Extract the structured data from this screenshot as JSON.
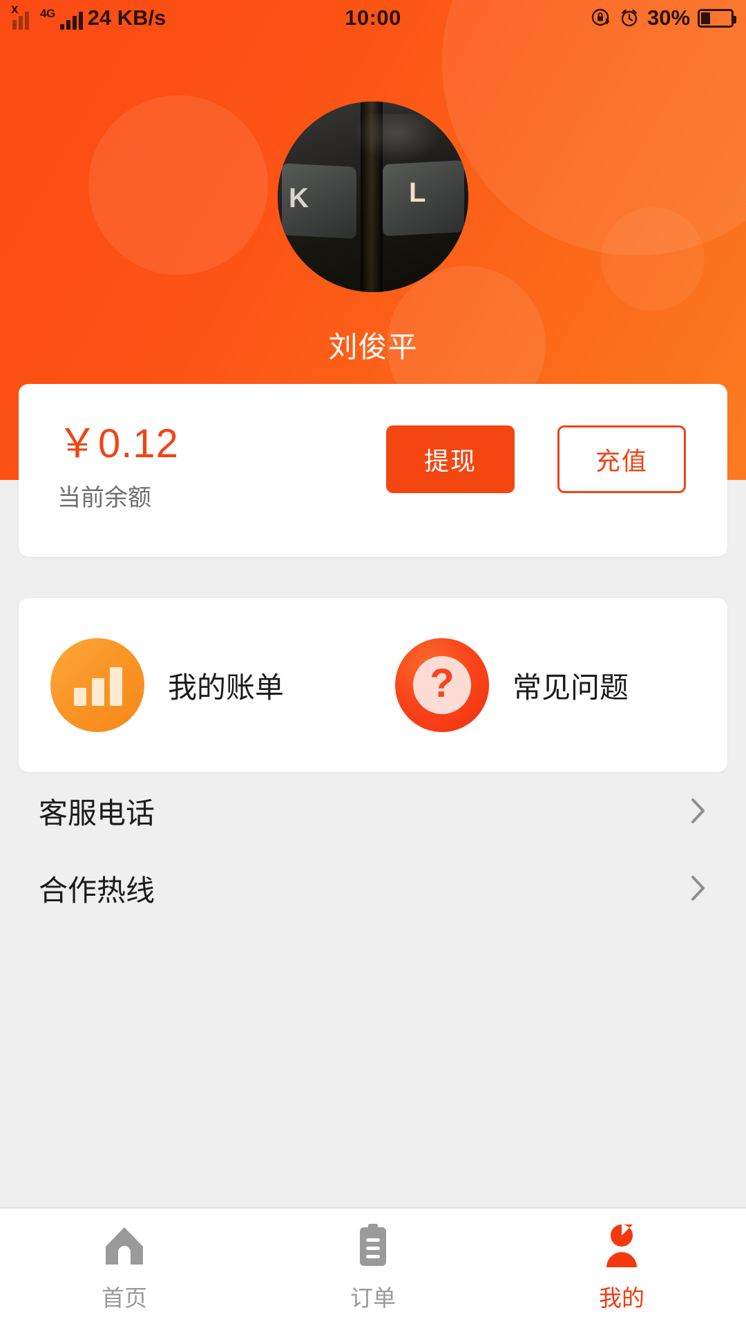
{
  "statusbar": {
    "network_x": "x",
    "network_type": "4G",
    "speed": "24 KB/s",
    "time": "10:00",
    "battery_percent": "30%",
    "battery_level": 30,
    "rotation_lock_icon": "rotation-lock-icon",
    "alarm_icon": "alarm-clock-icon",
    "signal_icon": "signal-bars-icon",
    "battery_icon": "battery-icon"
  },
  "header": {
    "avatar_icon": "user-avatar-photo",
    "avatar_key_left": "K",
    "avatar_key_right": "L",
    "username": "刘俊平",
    "bg_color": "#FC4B14"
  },
  "balance_card": {
    "amount": "￥0.12",
    "label": "当前余额",
    "withdraw_label": "提现",
    "recharge_label": "充值",
    "accent_color": "#F04414"
  },
  "menu_card": {
    "items": [
      {
        "label": "我的账单",
        "icon": "bar-chart-icon",
        "color": "#F99324"
      },
      {
        "label": "常见问题",
        "icon": "question-mark-icon",
        "color": "#F42E0E"
      }
    ]
  },
  "list": {
    "rows": [
      {
        "label": "客服电话",
        "icon": "chevron-right-icon"
      },
      {
        "label": "合作热线",
        "icon": "chevron-right-icon"
      }
    ]
  },
  "tabbar": {
    "items": [
      {
        "label": "首页",
        "icon": "home-icon",
        "active": false
      },
      {
        "label": "订单",
        "icon": "clipboard-icon",
        "active": false
      },
      {
        "label": "我的",
        "icon": "person-icon",
        "active": true
      }
    ],
    "active_color": "#F4390F",
    "inactive_color": "#9a9a9a"
  }
}
